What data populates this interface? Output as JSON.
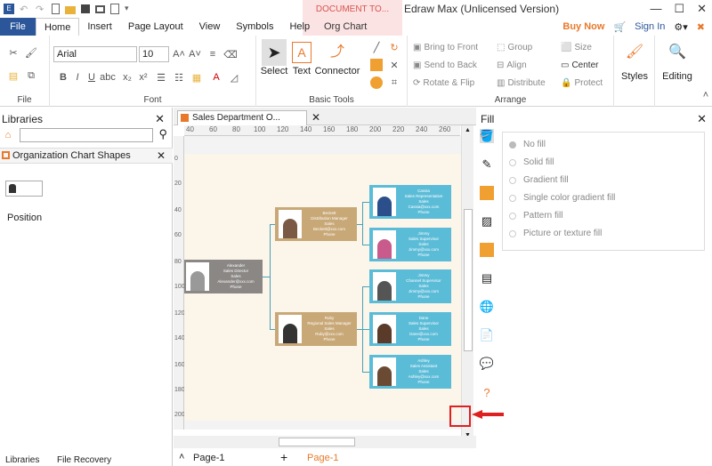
{
  "titlebar": {
    "document_tab": "DOCUMENT TO...",
    "app_title": "Edraw Max (Unlicensed Version)",
    "window_buttons": [
      "—",
      "☐",
      "✕"
    ]
  },
  "menu": {
    "file": "File",
    "tabs": [
      "Home",
      "Insert",
      "Page Layout",
      "View",
      "Symbols",
      "Help"
    ],
    "org_chart": "Org Chart",
    "buy_now": "Buy Now",
    "sign_in": "Sign In"
  },
  "ribbon": {
    "groups": {
      "file": "File",
      "font": "Font",
      "basic_tools": "Basic Tools",
      "arrange": "Arrange"
    },
    "font_name": "Arial",
    "font_size": "10",
    "select": "Select",
    "text": "Text",
    "connector": "Connector",
    "bring_to_front": "Bring to Front",
    "send_to_back": "Send to Back",
    "rotate_flip": "Rotate & Flip",
    "group": "Group",
    "align": "Align",
    "distribute": "Distribute",
    "size": "Size",
    "center": "Center",
    "protect": "Protect",
    "styles": "Styles",
    "editing": "Editing"
  },
  "libraries": {
    "title": "Libraries",
    "section": "Organization Chart Shapes",
    "position": "Position",
    "bottom_tabs": [
      "Libraries",
      "File Recovery"
    ]
  },
  "document": {
    "tab_title": "Sales Department O...",
    "ruler_top": [
      "40",
      "60",
      "80",
      "100",
      "120",
      "140",
      "160",
      "180",
      "200",
      "220",
      "240",
      "260"
    ],
    "ruler_left": [
      "0",
      "20",
      "40",
      "60",
      "80",
      "100",
      "120",
      "140",
      "160",
      "180",
      "200"
    ],
    "page_tab": "Page-1",
    "page_tab_active": "Page-1"
  },
  "org": {
    "root": {
      "name": "Alexander",
      "title": "Sales Director",
      "dept": "Sales",
      "email": "Alexander@xxx.com",
      "phone": "Phone"
    },
    "managers": [
      {
        "name": "Beckett",
        "title": "Distribution Manager",
        "dept": "Sales",
        "email": "Beckett@xxx.com",
        "phone": "Phone"
      },
      {
        "name": "Ruby",
        "title": "Regional Sales Manager",
        "dept": "Sales",
        "email": "Ruby@xxx.com",
        "phone": "Phone"
      }
    ],
    "staff": [
      {
        "name": "Cassia",
        "title": "Sales Representative",
        "dept": "Sales",
        "email": "Cassia@xxx.com",
        "phone": "Phone"
      },
      {
        "name": "Jimmy",
        "title": "Sales Supervisor",
        "dept": "Sales",
        "email": "Jimmy@xxx.com",
        "phone": "Phone"
      },
      {
        "name": "Jimmy",
        "title": "Channel Supervisor",
        "dept": "Sales",
        "email": "Jimmy@xxx.com",
        "phone": "Phone"
      },
      {
        "name": "Dane",
        "title": "Sales Supervisor",
        "dept": "Sales",
        "email": "Dane@xxx.com",
        "phone": "Phone"
      },
      {
        "name": "Ashley",
        "title": "Sales Assistant",
        "dept": "Sales",
        "email": "Ashley@xxx.com",
        "phone": "Phone"
      }
    ]
  },
  "fill": {
    "title": "Fill",
    "options": [
      "No fill",
      "Solid fill",
      "Gradient fill",
      "Single color gradient fill",
      "Pattern fill",
      "Picture or texture fill"
    ]
  },
  "colors": {
    "accent": "#2b579a",
    "buy_now": "#e8792b",
    "root_node": "#8a8785",
    "manager_node": "#c9a877",
    "staff_node": "#5bbcd8",
    "highlight": "#e02020"
  }
}
